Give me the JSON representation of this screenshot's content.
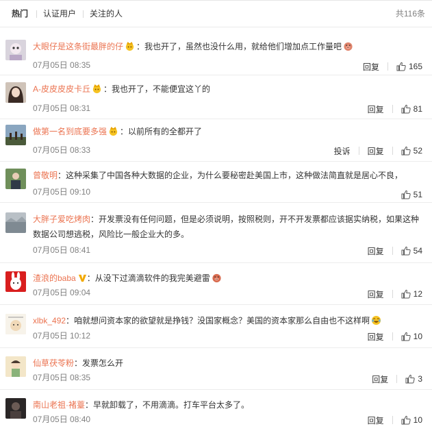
{
  "tabs": [
    {
      "label": "热门",
      "active": true
    },
    {
      "label": "认证用户",
      "active": false
    },
    {
      "label": "关注的人",
      "active": false
    }
  ],
  "total_count": "共116条",
  "reply_label": "回复",
  "report_label": "投诉",
  "colors": {
    "username": "#eb7350",
    "meta": "#808080",
    "accent_crown": "#f0a000"
  },
  "comments": [
    {
      "user": "大眼仔是这条街最胖的仔",
      "emoji_after_user": "crown-icon",
      "sep": "：",
      "content": "我也开了，虽然也没什么用，就给他们增加点工作量吧",
      "trailing_emoji": "pig-icon",
      "time": "07月05日 08:35",
      "likes": "165",
      "report": false
    },
    {
      "user": "A-皮皮皮皮卡丘",
      "emoji_after_user": "crown-icon",
      "sep": "：",
      "content": "我也开了，不能便宜这丫的",
      "trailing_emoji": "",
      "time": "07月05日 08:31",
      "likes": "81",
      "report": false
    },
    {
      "user": "做第一名到底要多强",
      "emoji_after_user": "crown-icon",
      "sep": "：",
      "content": "以前所有的全都开了",
      "trailing_emoji": "",
      "time": "07月05日 08:33",
      "likes": "52",
      "report": true
    },
    {
      "user": "曾敬明",
      "emoji_after_user": "",
      "sep": "：",
      "content": "这种采集了中国各种大数据的企业，为什么要秘密赴美国上市，这种做法简直就是居心不良，",
      "trailing_emoji": "",
      "time": "07月05日 09:10",
      "likes": "51",
      "report": false
    },
    {
      "user": "大胖子爱吃烤肉",
      "emoji_after_user": "",
      "sep": "：",
      "content": "开发票没有任何问题，但是必须说明，按照税则，开不开发票都应该据实纳税，如果这种数据公司想逃税，风险比一般企业大的多。",
      "trailing_emoji": "",
      "time": "07月05日 08:41",
      "likes": "54",
      "report": false
    },
    {
      "user": "渣浪的baba",
      "emoji_after_user": "vip-icon",
      "sep": "：",
      "content": "从没下过滴滴软件的我完美避雷",
      "trailing_emoji": "pig-icon",
      "time": "07月05日 09:04",
      "likes": "12",
      "report": false
    },
    {
      "user": "xlbk_492",
      "emoji_after_user": "",
      "sep": "：",
      "content": "咱就想问资本家的欲望就是挣钱？没国家概念？美国的资本家那么自由也不这样啊",
      "trailing_emoji": "laugh-cry-icon",
      "time": "07月05日 10:12",
      "likes": "10",
      "report": false
    },
    {
      "user": "仙草茯苓粉",
      "emoji_after_user": "",
      "sep": "：",
      "content": "发票怎么开",
      "trailing_emoji": "",
      "time": "07月05日 08:35",
      "likes": "3",
      "report": false
    },
    {
      "user": "南山老祖·褚薹",
      "emoji_after_user": "",
      "sep": "：",
      "content": "早就卸载了，不用滴滴。打车平台太多了。",
      "trailing_emoji": "",
      "time": "07月05日 08:40",
      "likes": "10",
      "report": false
    }
  ]
}
